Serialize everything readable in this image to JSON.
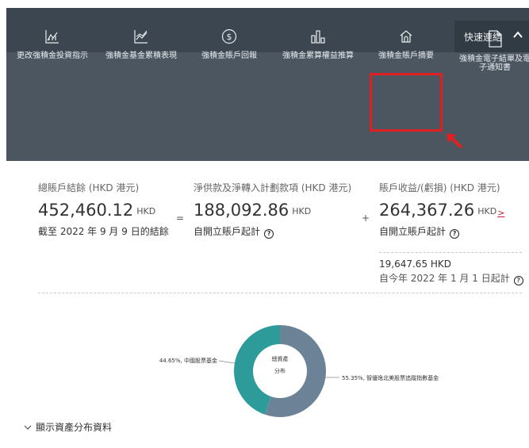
{
  "quick_links": {
    "label": "快速連結"
  },
  "nav_items": [
    {
      "label": "更改強積金投資指示",
      "icon": "chart-edit-icon"
    },
    {
      "label": "強積金基金累積表現",
      "icon": "line-chart-icon"
    },
    {
      "label": "強積金賬戶回報",
      "icon": "dollar-circle-icon"
    },
    {
      "label": "強積金累算權益推算",
      "icon": "bar-chart-icon"
    },
    {
      "label": "強積金賬戶摘要",
      "icon": "home-icon"
    },
    {
      "label": "強積金電子結單及電子通知書",
      "icon": "document-icon"
    }
  ],
  "summary": {
    "total": {
      "label": "總賬戶結餘 (HKD 港元)",
      "amount": "452,460.12",
      "unit": "HKD",
      "sub": "截至 2022 年 9 月 9 日的結餘"
    },
    "contrib": {
      "label": "淨供款及淨轉入計劃款項 (HKD 港元)",
      "amount": "188,092.86",
      "unit": "HKD",
      "sub": "自開立賬戶起計"
    },
    "gain": {
      "label": "賬戶收益/(虧損) (HKD 港元)",
      "amount": "264,367.26",
      "unit": "HKD",
      "link": ">",
      "sub": "自開立賬戶起計"
    },
    "ytd": {
      "value": "19,647.65 HKD",
      "sub": "自今年 2022 年 1 月 1 日起計"
    },
    "ops": {
      "eq": "=",
      "plus": "+"
    }
  },
  "chart_data": {
    "type": "pie",
    "title": "總資產分布",
    "categories": [
      "中國股票基金",
      "智優逸北美股票追蹤指數基金"
    ],
    "values": [
      44.65,
      55.35
    ],
    "labels": [
      "44.65%, 中國股票基金",
      "55.35%, 智優逸北美股票追蹤指數基金"
    ],
    "colors": [
      "#2e9b9b",
      "#6c8296"
    ]
  },
  "toggle": {
    "label": "顯示資產分布資料"
  },
  "colors": {
    "highlight": "#e02020",
    "nav_bg": "#4b5661",
    "top_bg": "#3b4650"
  }
}
